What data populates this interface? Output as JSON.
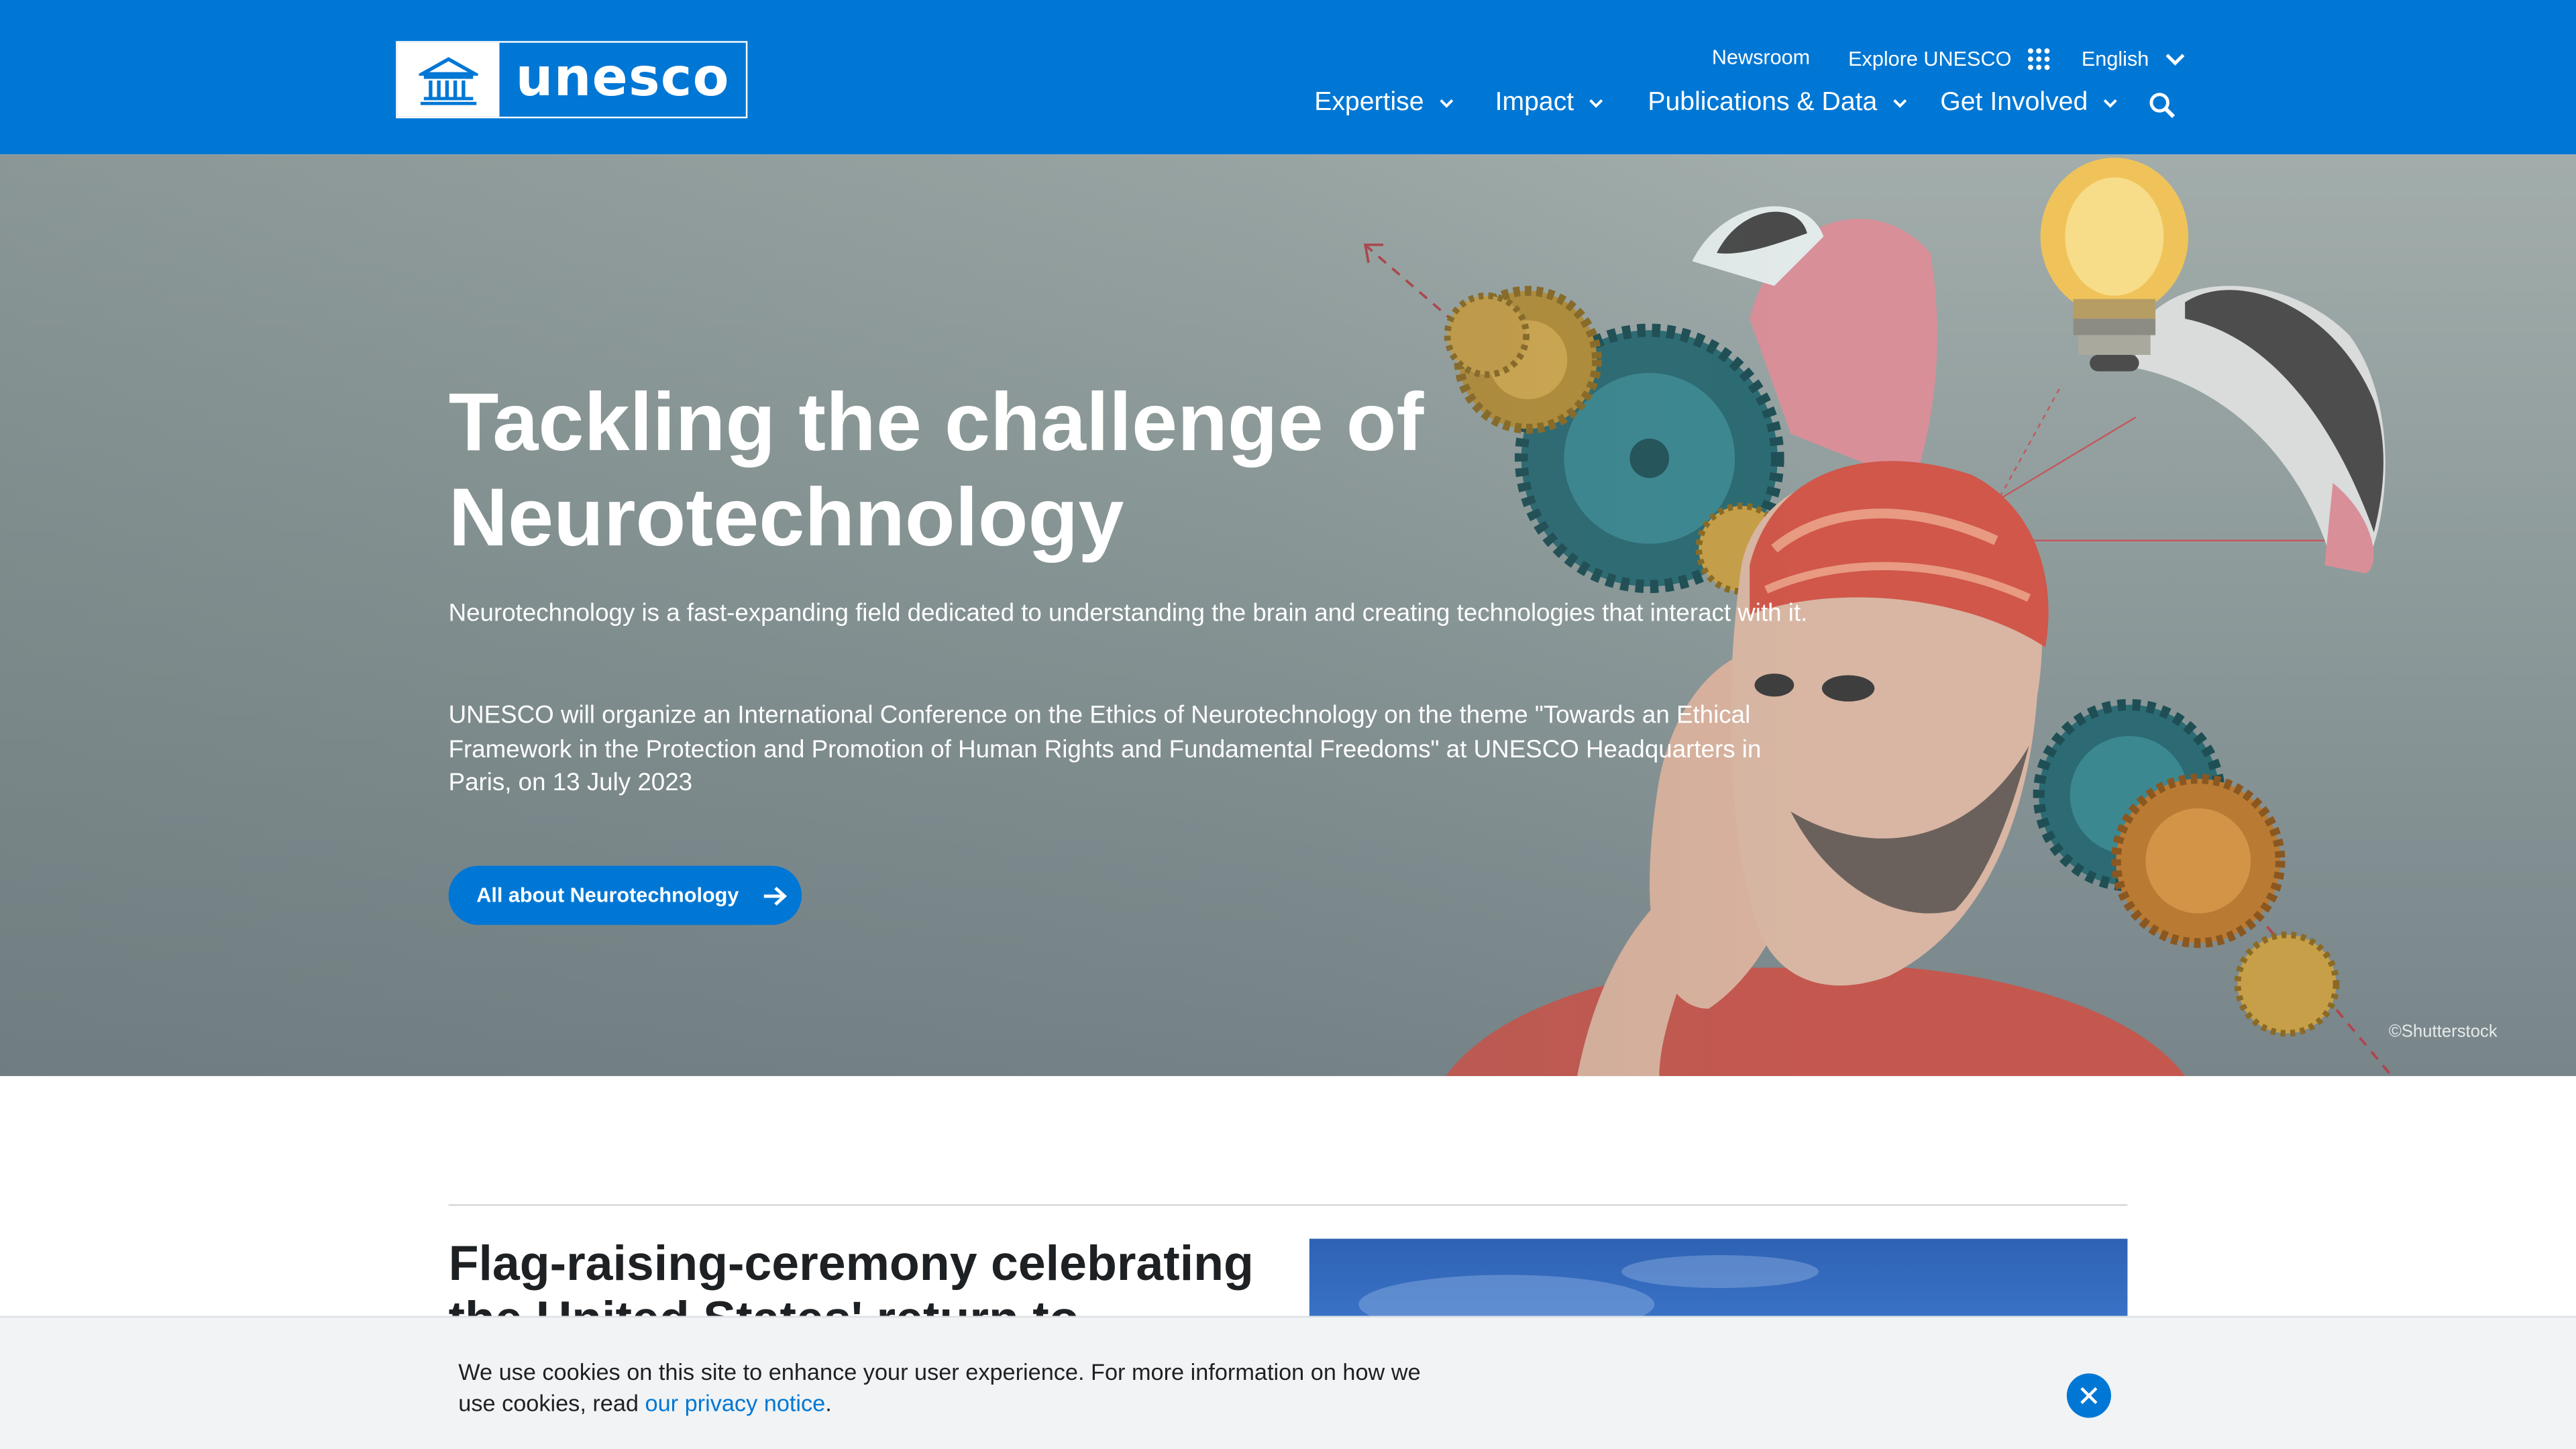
{
  "header": {
    "logo_text": "unesco",
    "utility": {
      "newsroom": "Newsroom",
      "explore": "Explore UNESCO",
      "language": "English"
    },
    "nav": {
      "expertise": "Expertise",
      "impact": "Impact",
      "publications": "Publications & Data",
      "get_involved": "Get Involved"
    }
  },
  "hero": {
    "title": "Tackling the challenge of Neurotechnology",
    "paragraph_1": "Neurotechnology is a fast-expanding field dedicated to understanding the brain and creating technologies that interact with it.",
    "paragraph_2": "UNESCO will organize an International Conference on the Ethics of Neurotechnology on the theme \"Towards an Ethical Framework in the Protection and Promotion of Human Rights and Fundamental Freedoms\" at UNESCO Headquarters in Paris, on 13 July 2023",
    "cta_label": "All about Neurotechnology",
    "credit": "©Shutterstock"
  },
  "news": {
    "title": "Flag-raising-ceremony celebrating the United States' return to"
  },
  "cookie_banner": {
    "text_before": "We use cookies on this site to enhance your user experience. For more information on how we use cookies, read ",
    "link_text": "our privacy notice",
    "text_after": "."
  },
  "colors": {
    "brand_blue": "#0077d4",
    "header_text": "#ffffff",
    "cookie_bg": "#f1f3f5"
  }
}
